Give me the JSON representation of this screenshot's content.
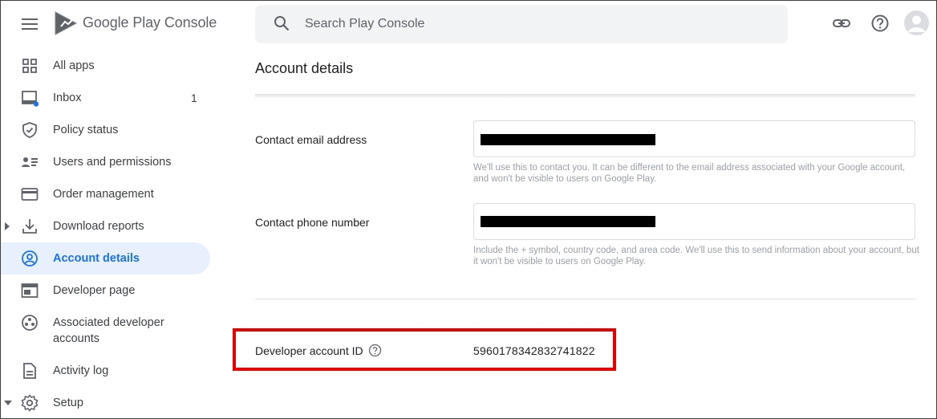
{
  "header": {
    "brand": "Google Play Console",
    "search_placeholder": "Search Play Console"
  },
  "sidebar": {
    "items": [
      {
        "label": "All apps",
        "icon": "grid-icon"
      },
      {
        "label": "Inbox",
        "icon": "inbox-icon",
        "badge": "1"
      },
      {
        "label": "Policy status",
        "icon": "shield-check-icon"
      },
      {
        "label": "Users and permissions",
        "icon": "users-list-icon"
      },
      {
        "label": "Order management",
        "icon": "credit-card-icon"
      },
      {
        "label": "Download reports",
        "icon": "download-icon"
      },
      {
        "label": "Account details",
        "icon": "account-circle-icon",
        "active": true
      },
      {
        "label": "Developer page",
        "icon": "web-page-icon"
      },
      {
        "label": "Associated developer accounts",
        "icon": "linked-accounts-icon"
      },
      {
        "label": "Activity log",
        "icon": "document-icon"
      },
      {
        "label": "Setup",
        "icon": "gear-icon"
      }
    ]
  },
  "main": {
    "title": "Account details",
    "email": {
      "label": "Contact email address",
      "help": "We'll use this to contact you. It can be different to the email address associated with your Google account, and won't be visible to users on Google Play."
    },
    "phone": {
      "label": "Contact phone number",
      "help": "Include the + symbol, country code, and area code. We'll use this to send information about your account, but it won't be visible to users on Google Play."
    },
    "developer_id": {
      "label": "Developer account ID",
      "value": "5960178342832741822"
    }
  },
  "colors": {
    "accent": "#1a73e8",
    "active_bg": "#e8f0fe",
    "highlight": "#e60000"
  }
}
